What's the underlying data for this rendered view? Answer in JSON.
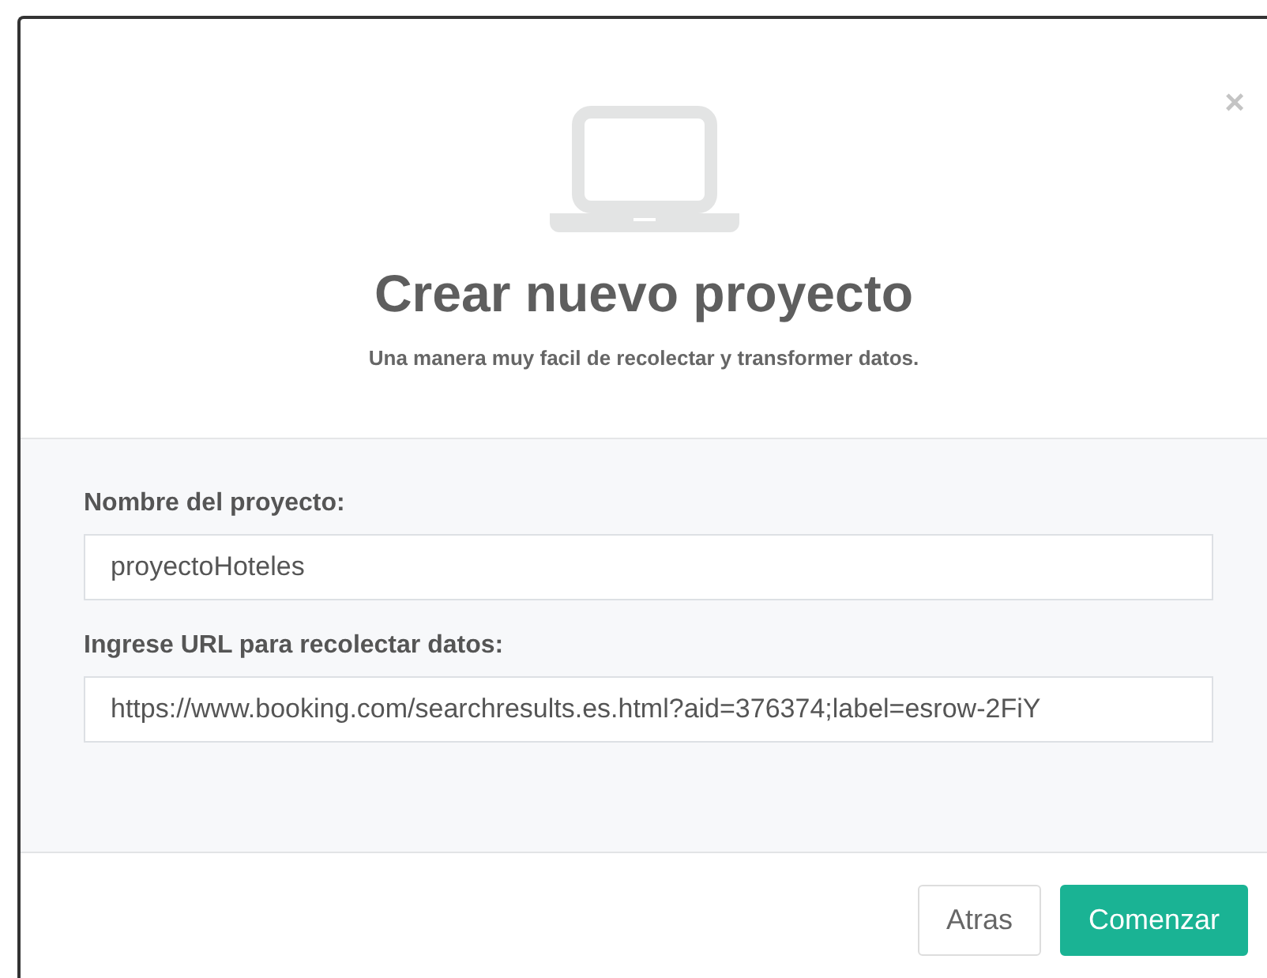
{
  "dialog": {
    "title": "Crear nuevo proyecto",
    "subtitle": "Una manera muy facil de recolectar y transformer datos.",
    "close": "×"
  },
  "fields": [
    {
      "label": "Nombre del proyecto:",
      "value": "proyectoHoteles"
    },
    {
      "label": "Ingrese URL para recolectar datos:",
      "value": "https://www.booking.com/searchresults.es.html?aid=376374;label=esrow-2FiY"
    }
  ],
  "buttons": [
    {
      "label": "Atras",
      "kind": "secondary"
    },
    {
      "label": "Comenzar",
      "kind": "primary"
    }
  ]
}
